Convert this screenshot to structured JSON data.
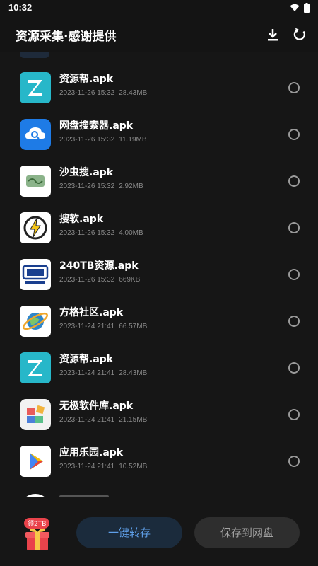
{
  "status_bar": {
    "time": "10:32"
  },
  "app_bar": {
    "title": "资源采集·感谢提供",
    "download_icon": "download-icon",
    "refresh_icon": "refresh-icon"
  },
  "files": [
    {
      "name": "资源帮.apk",
      "date": "2023-11-26 15:32",
      "size": "28.43MB",
      "icon": "z-app-icon",
      "selected": false
    },
    {
      "name": "网盘搜索器.apk",
      "date": "2023-11-26 15:32",
      "size": "11.19MB",
      "icon": "cloud-search-icon",
      "selected": false
    },
    {
      "name": "沙虫搜.apk",
      "date": "2023-11-26 15:32",
      "size": "2.92MB",
      "icon": "shachong-icon",
      "selected": false
    },
    {
      "name": "搜软.apk",
      "date": "2023-11-26 15:32",
      "size": "4.00MB",
      "icon": "lightning-icon",
      "selected": false
    },
    {
      "name": "240TB资源.apk",
      "date": "2023-11-26 15:32",
      "size": "669KB",
      "icon": "240tb-icon",
      "selected": false
    },
    {
      "name": "方格社区.apk",
      "date": "2023-11-24 21:41",
      "size": "66.57MB",
      "icon": "planet-icon",
      "selected": false
    },
    {
      "name": "资源帮.apk",
      "date": "2023-11-24 21:41",
      "size": "28.43MB",
      "icon": "z-app-icon",
      "selected": false
    },
    {
      "name": "无极软件库.apk",
      "date": "2023-11-24 21:41",
      "size": "21.15MB",
      "icon": "wuji-icon",
      "selected": false
    },
    {
      "name": "应用乐园.apk",
      "date": "2023-11-24 21:41",
      "size": "10.52MB",
      "icon": "play-icon",
      "selected": false
    }
  ],
  "bottom_bar": {
    "gift_badge": "领2TB",
    "transfer_label": "一键转存",
    "save_label": "保存到网盘"
  },
  "colors": {
    "background": "#161616",
    "accent": "#5fa0ea",
    "badge": "#e9434b"
  }
}
